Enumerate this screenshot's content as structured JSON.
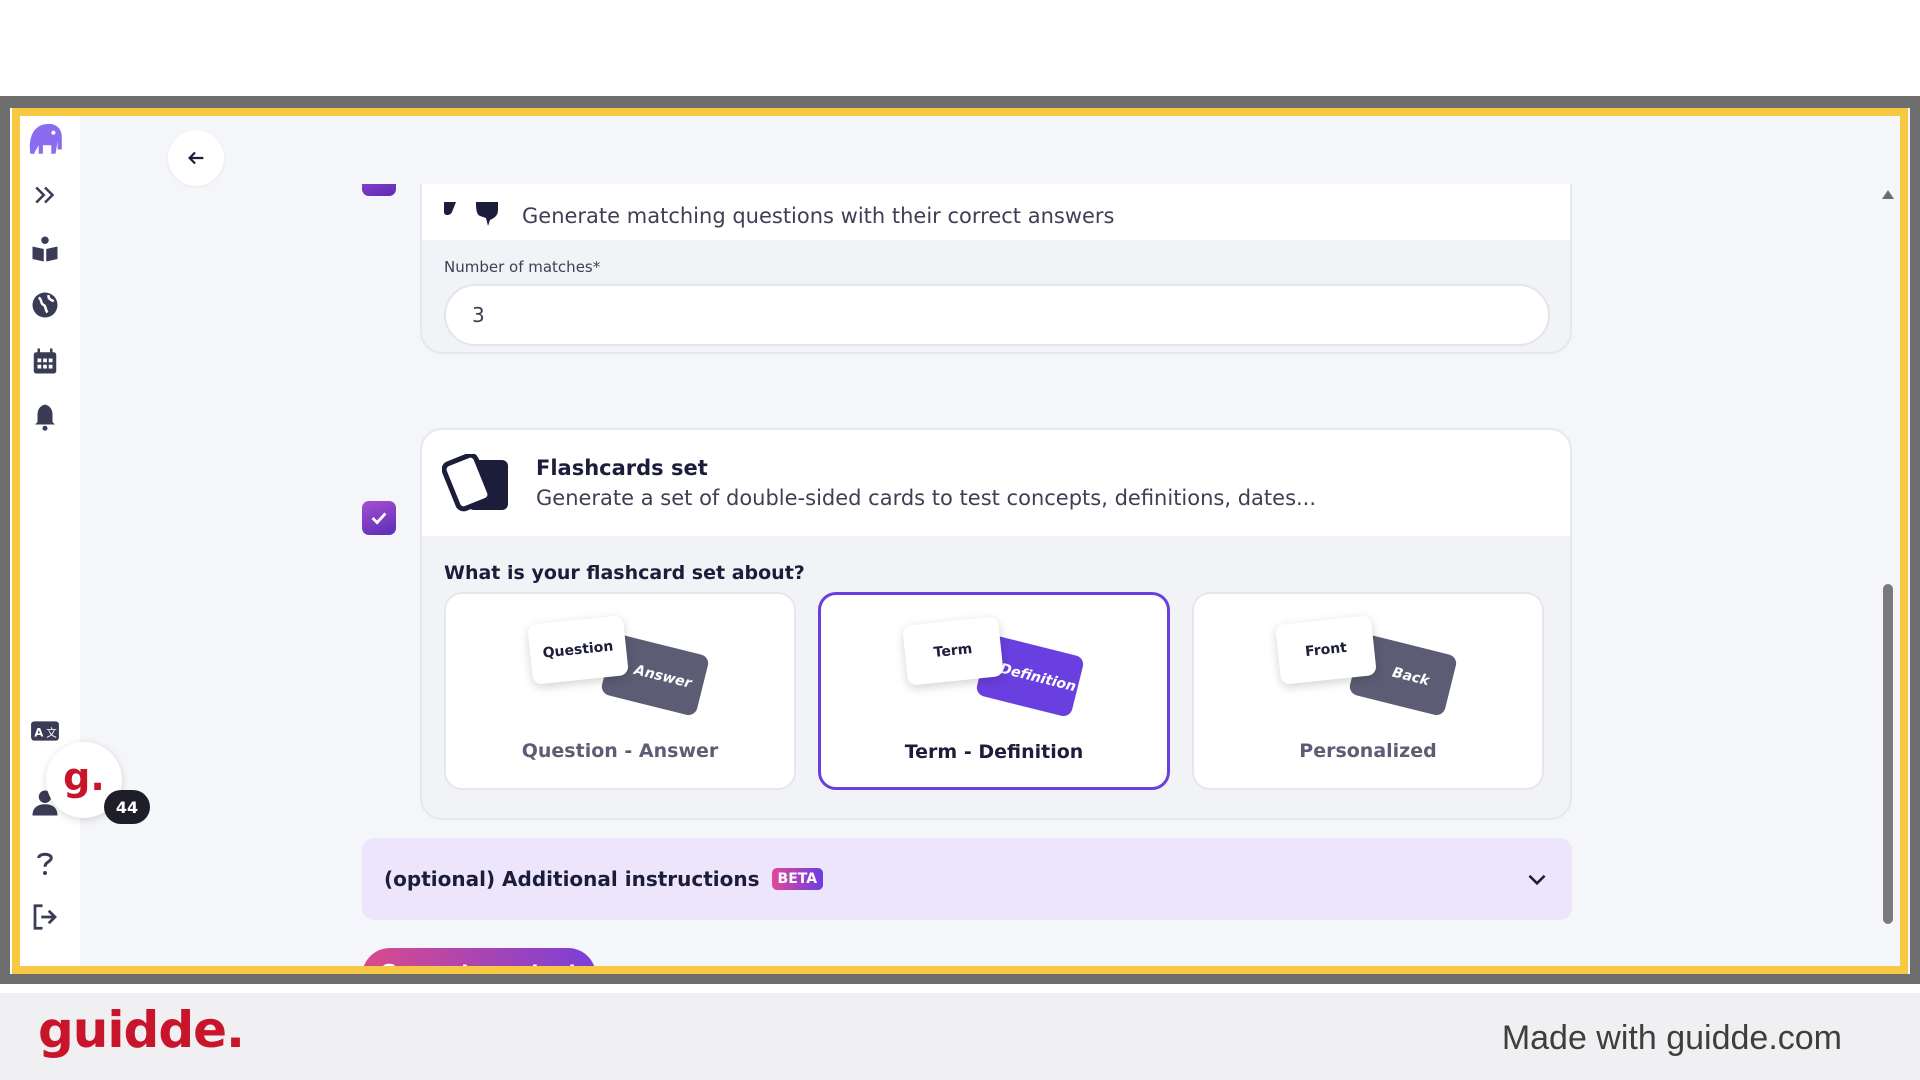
{
  "sidebar": {
    "icons": [
      "elephant-logo-icon",
      "expand-icon",
      "book-reader-icon",
      "globe-icon",
      "calendar-icon",
      "bell-icon",
      "translate-icon",
      "user-icon",
      "help-icon",
      "logout-icon"
    ]
  },
  "matching": {
    "description": "Generate matching questions with their correct answers",
    "field_label": "Number of matches*",
    "field_value": "3"
  },
  "flashcards": {
    "title": "Flashcards set",
    "subtitle": "Generate a set of double-sided cards to test concepts, definitions, dates...",
    "question": "What is your flashcard set about?",
    "options": [
      {
        "label": "Question - Answer",
        "front": "Question",
        "back": "Answer",
        "selected": false
      },
      {
        "label": "Term - Definition",
        "front": "Term",
        "back": "Definition",
        "selected": true
      },
      {
        "label": "Personalized",
        "front": "Front",
        "back": "Back",
        "selected": false
      }
    ]
  },
  "accordion": {
    "label": "(optional) Additional instructions",
    "badge": "BETA"
  },
  "generate_label": "Generate content",
  "guidde": {
    "badge_letter": "g.",
    "count": "44"
  },
  "footer": {
    "logo": "guidde.",
    "made_with": "Made with guidde.com"
  },
  "colors": {
    "accent": "#6a3fe0",
    "highlight": "#f6c843",
    "brand_red": "#c8152b"
  }
}
